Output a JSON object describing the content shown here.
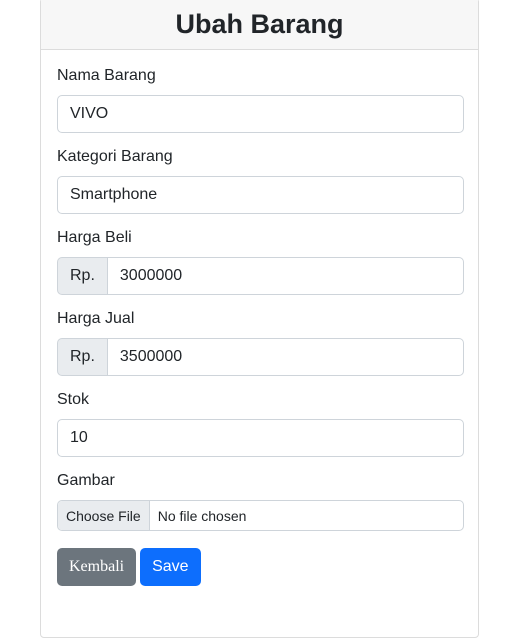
{
  "header": {
    "title": "Ubah Barang"
  },
  "form": {
    "nama": {
      "label": "Nama Barang",
      "value": "VIVO"
    },
    "kategori": {
      "label": "Kategori Barang",
      "value": "Smartphone"
    },
    "harga_beli": {
      "label": "Harga Beli",
      "prefix": "Rp.",
      "value": "3000000"
    },
    "harga_jual": {
      "label": "Harga Jual",
      "prefix": "Rp.",
      "value": "3500000"
    },
    "stok": {
      "label": "Stok",
      "value": "10"
    },
    "gambar": {
      "label": "Gambar",
      "button": "Choose File",
      "status": "No file chosen"
    }
  },
  "actions": {
    "back_label": "Kembali",
    "save_label": "Save"
  },
  "colors": {
    "back": "#6c757d",
    "save": "#0d6efd",
    "header_bg": "#f7f7f7"
  }
}
